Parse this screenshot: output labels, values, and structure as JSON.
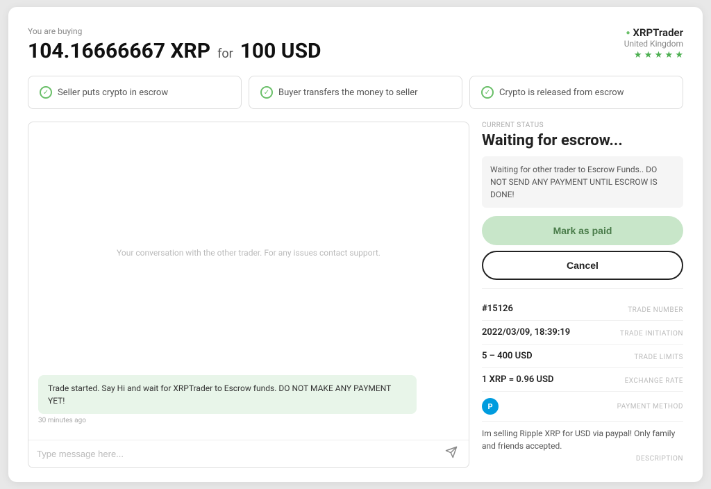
{
  "header": {
    "buying_label": "You are buying",
    "crypto_amount": "104.16666667 XRP",
    "for_text": "for",
    "fiat_amount": "100 USD"
  },
  "trader": {
    "name": "XRPTrader",
    "country": "United Kingdom",
    "stars": "★ ★ ★ ★ ★"
  },
  "steps": [
    {
      "label": "Seller puts crypto in escrow",
      "done": true
    },
    {
      "label": "Buyer transfers the money to seller",
      "done": true
    },
    {
      "label": "Crypto is released from escrow",
      "done": true
    }
  ],
  "chat": {
    "placeholder": "Your conversation with the other trader. For any issues contact support.",
    "message": "Trade started. Say Hi and wait for XRPTrader to Escrow funds. DO NOT MAKE ANY PAYMENT YET!",
    "time": "30 minutes ago",
    "input_placeholder": "Type message here..."
  },
  "status": {
    "current_label": "CURRENT STATUS",
    "title": "Waiting for escrow...",
    "note": "Waiting for other trader to Escrow Funds.. DO NOT SEND ANY PAYMENT UNTIL ESCROW IS DONE!",
    "mark_paid_label": "Mark as paid",
    "cancel_label": "Cancel"
  },
  "trade_details": {
    "trade_number_label": "TRADE NUMBER",
    "trade_number": "#15126",
    "initiation_label": "TRADE INITIATION",
    "initiation": "2022/03/09, 18:39:19",
    "limits_label": "TRADE LIMITS",
    "limits": "5 – 400 USD",
    "exchange_label": "EXCHANGE RATE",
    "exchange": "1 XRP = 0.96 USD",
    "payment_label": "PAYMENT METHOD",
    "description_label": "DESCRIPTION",
    "description": "Im selling Ripple XRP for USD via paypal! Only family and friends accepted."
  },
  "colors": {
    "green": "#4caf50",
    "light_green_bg": "#c8e6c9",
    "chat_bubble_bg": "#e8f5e9"
  }
}
